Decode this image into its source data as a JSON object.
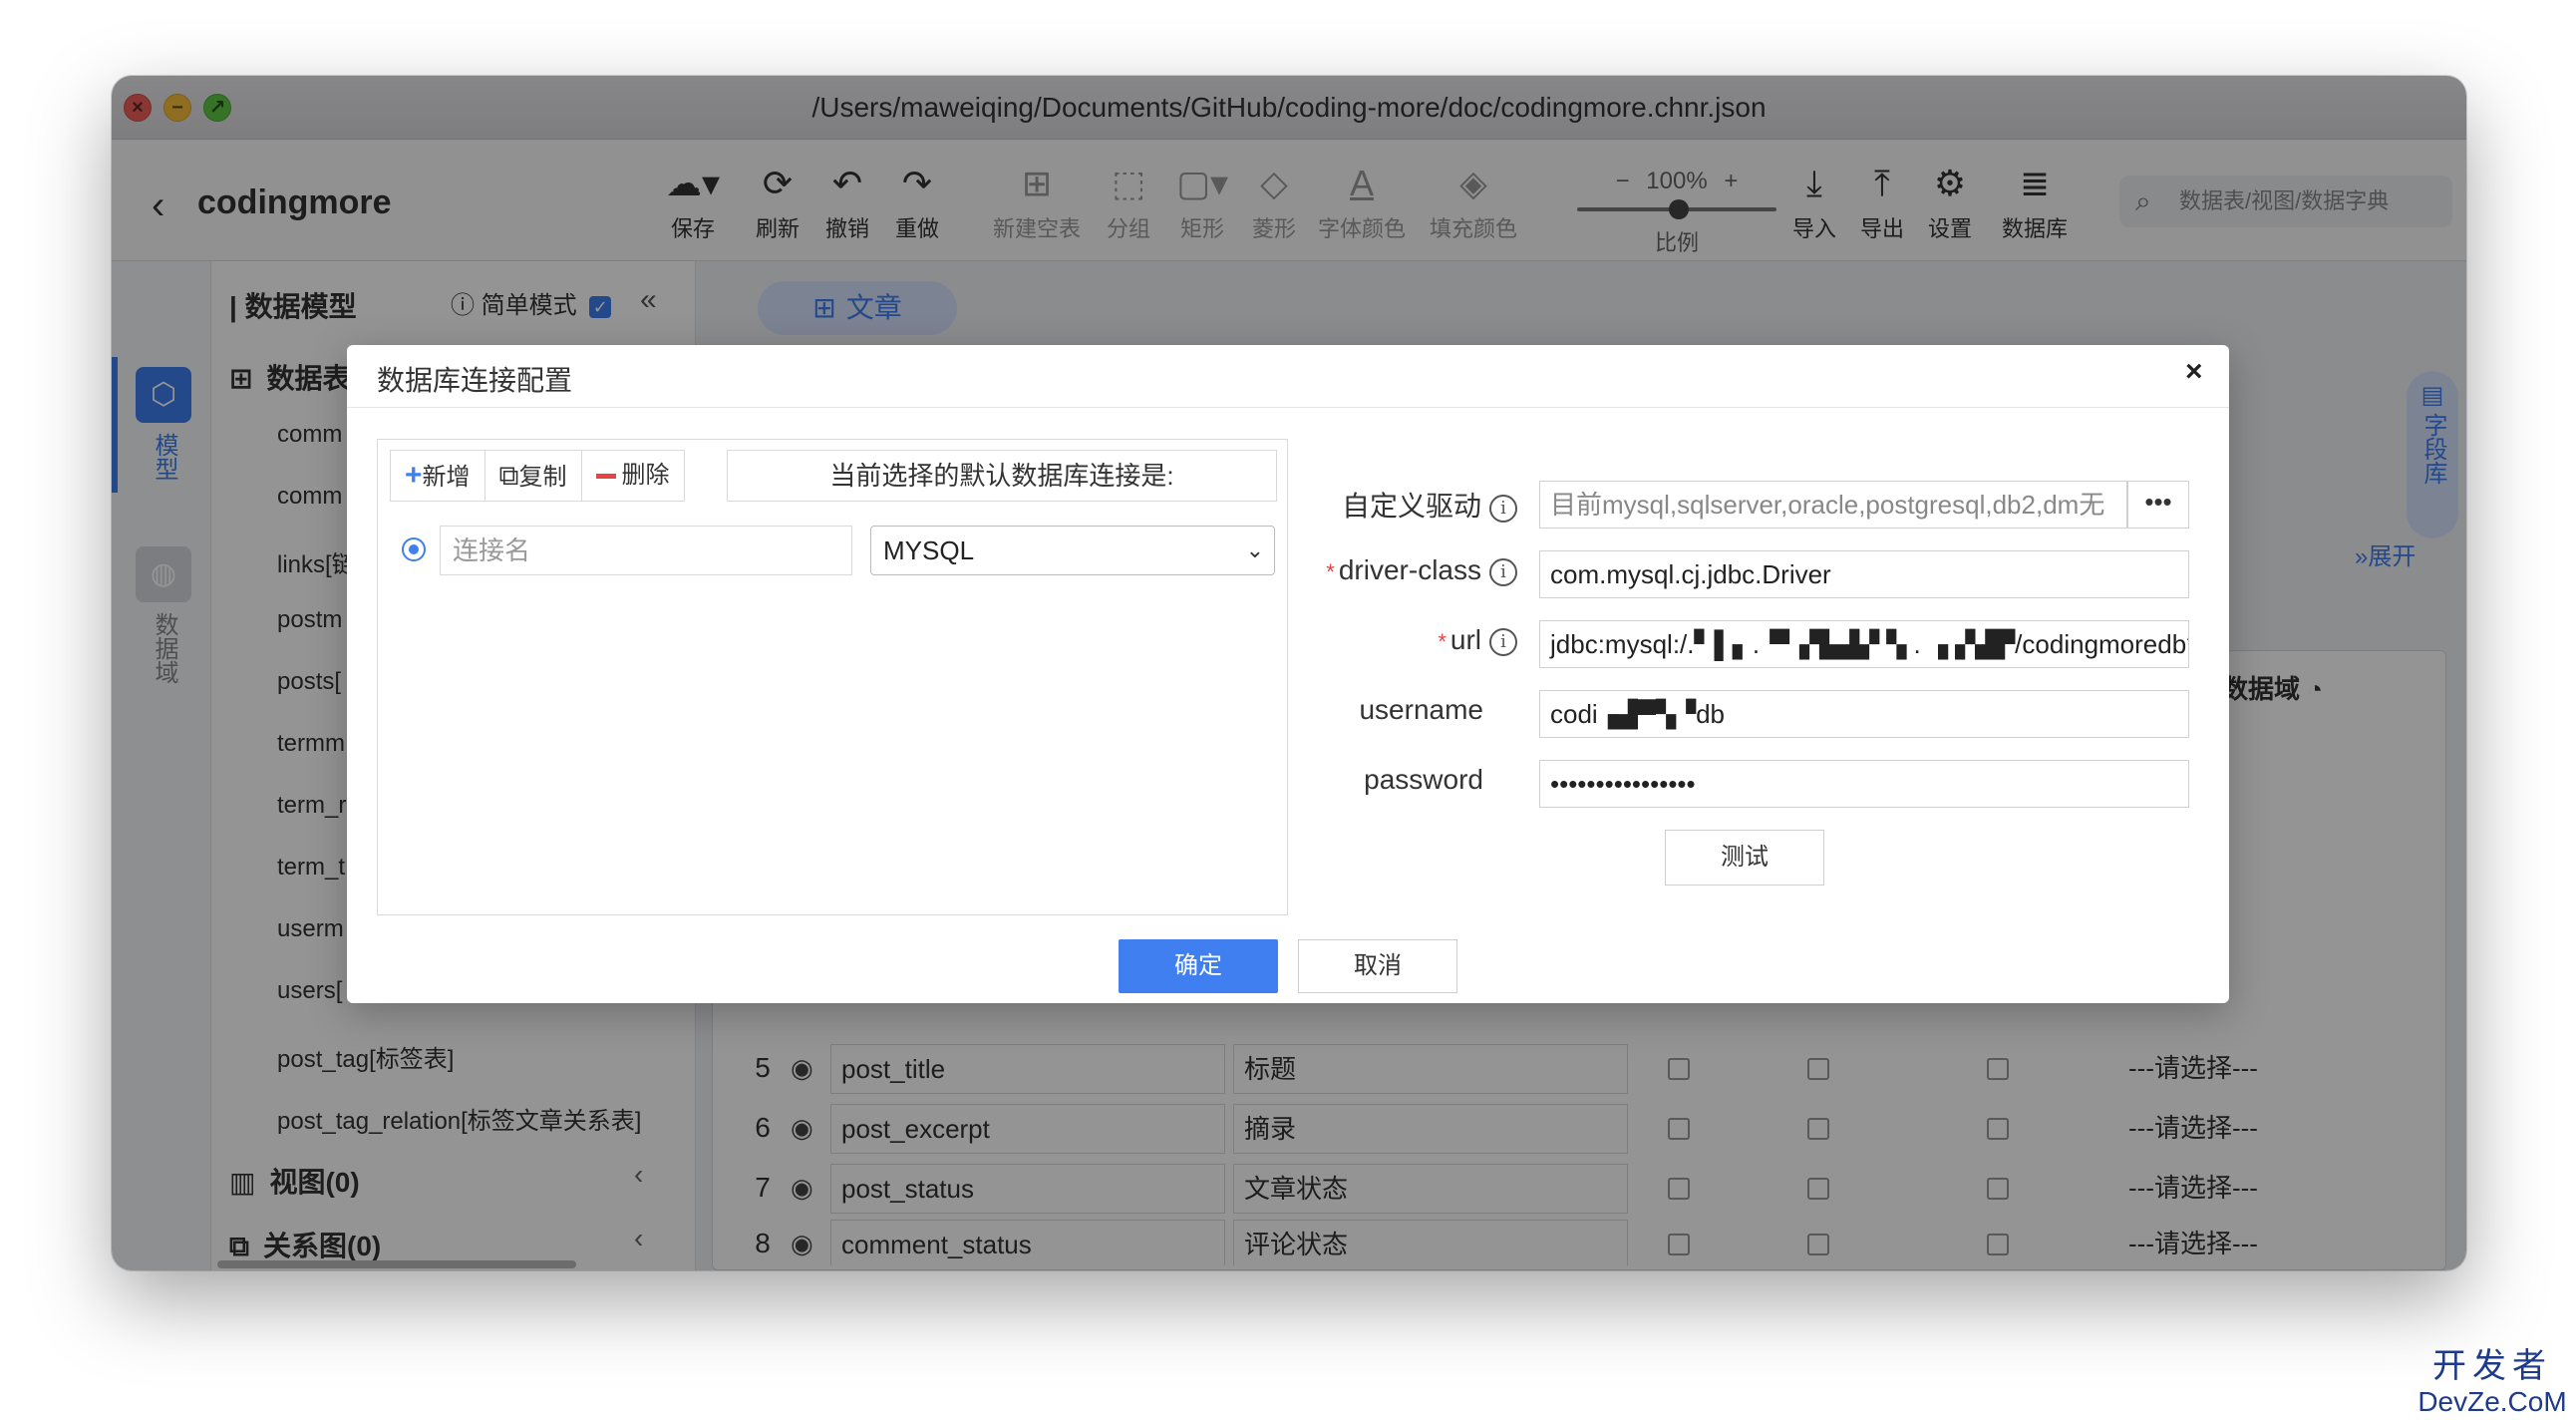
{
  "window": {
    "title": "/Users/maweiqing/Documents/GitHub/coding-more/doc/codingmore.chnr.json"
  },
  "toolbar": {
    "project": "codingmore",
    "tools": [
      {
        "icon": "↻",
        "label": "保存"
      },
      {
        "icon": "⟳",
        "label": "刷新"
      },
      {
        "icon": "↶",
        "label": "撤销"
      },
      {
        "icon": "↷",
        "label": "重做"
      },
      {
        "icon": "⊞",
        "label": "新建空表"
      },
      {
        "icon": "⬚",
        "label": "分组"
      },
      {
        "icon": "▢",
        "label": "矩形"
      },
      {
        "icon": "◇",
        "label": "菱形"
      },
      {
        "icon": "A",
        "label": "字体颜色"
      },
      {
        "icon": "◈",
        "label": "填充颜色"
      },
      {
        "icon": "⤓",
        "label": "导入"
      },
      {
        "icon": "⤒",
        "label": "导出"
      },
      {
        "icon": "⚙",
        "label": "设置"
      },
      {
        "icon": "≣",
        "label": "数据库"
      }
    ],
    "zoom": {
      "minus": "−",
      "value": "100%",
      "plus": "+",
      "label": "比例"
    },
    "search_placeholder": "数据表/视图/数据字典"
  },
  "rail": {
    "model": "模型",
    "domain": "数据域"
  },
  "sidebar": {
    "title": "数据模型",
    "mode": "简单模式",
    "tables_group": "数据表",
    "items": [
      "comm",
      "comm",
      "links[链",
      "postm",
      "posts[",
      "termm",
      "term_r",
      "term_t",
      "userm",
      "users[",
      "post_tag[标签表]",
      "post_tag_relation[标签文章关系表]"
    ],
    "views": "视图(0)",
    "relations": "关系图(0)"
  },
  "main": {
    "tab": "文章",
    "field_lib": "字段库",
    "expand": "展开",
    "domain_header": "数据域",
    "rows": [
      {
        "num": "5",
        "name": "post_title",
        "comment": "标题",
        "domain": "---请选择---"
      },
      {
        "num": "6",
        "name": "post_excerpt",
        "comment": "摘录",
        "domain": "---请选择---"
      },
      {
        "num": "7",
        "name": "post_status",
        "comment": "文章状态",
        "domain": "---请选择---"
      },
      {
        "num": "8",
        "name": "comment_status",
        "comment": "评论状态",
        "domain": "---请选择---"
      }
    ],
    "upper_domains": [
      "---",
      "---",
      "---"
    ]
  },
  "modal": {
    "title": "数据库连接配置",
    "close": "×",
    "add": "新增",
    "copy": "复制",
    "delete": "删除",
    "current_default": "当前选择的默认数据库连接是:",
    "conn_name_placeholder": "连接名",
    "db_type": "MYSQL",
    "labels": {
      "custom_driver": "自定义驱动",
      "driver_class": "driver-class",
      "url": "url",
      "username": "username",
      "password": "password"
    },
    "values": {
      "custom_driver_placeholder": "目前mysql,sqlserver,oracle,postgresql,db2,dm无",
      "driver_class": "com.mysql.cj.jdbc.Driver",
      "url": "jdbc:mysql:/.▘▌▖.▝▘▞▙▟▞ ▚ . ▗ ▞▟▛/codingmoredb?cha",
      "username": "codi▗▟▀▚▝db",
      "password": "••••••••••••••••"
    },
    "more": "•••",
    "test": "测试",
    "ok": "确定",
    "cancel": "取消"
  },
  "watermark": {
    "line1": "开发者",
    "line2": "DevZe.CoM"
  }
}
